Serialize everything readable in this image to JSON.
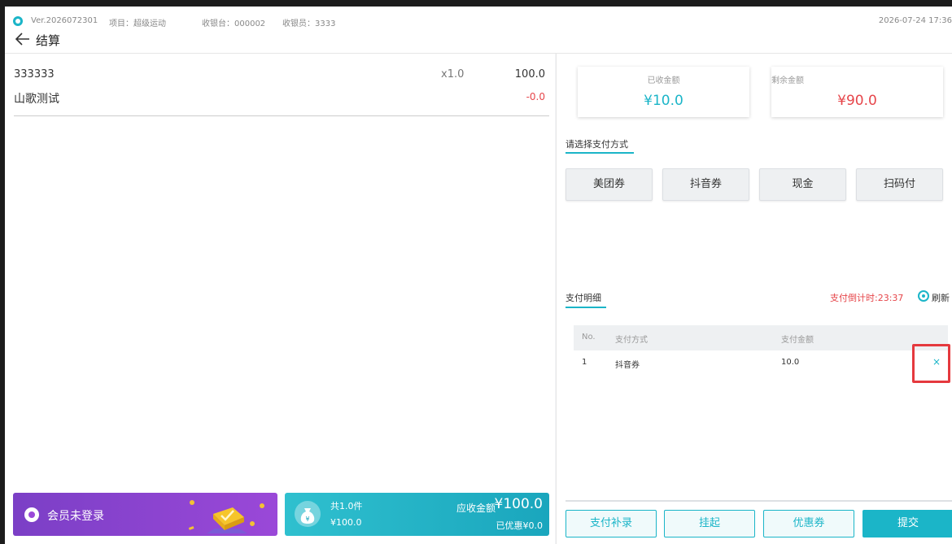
{
  "header": {
    "version": "Ver.2026072301",
    "project": "项目：超级运动",
    "counter": "收银台：000002",
    "cashier": "收银员：3333",
    "datetime": "2026-07-24 17:36",
    "page_title": "结算"
  },
  "order": {
    "item": {
      "name": "333333",
      "qty": "x1.0",
      "price": "100.0",
      "sub_name": "山歌测试",
      "discount": "-0.0"
    }
  },
  "member": {
    "label": "会员未登录"
  },
  "summary": {
    "count": "共1.0件",
    "total": "¥100.0",
    "due_label": "应收金额",
    "due_amount": "¥100.0",
    "discount": "已优惠¥0.0"
  },
  "amounts": {
    "received_label": "已收金额",
    "received_value": "¥10.0",
    "remaining_label": "剩余金额",
    "remaining_value": "¥90.0"
  },
  "payment_methods": {
    "title": "请选择支付方式",
    "options": [
      "美团券",
      "抖音券",
      "现金",
      "扫码付"
    ]
  },
  "payment_details": {
    "title": "支付明细",
    "countdown": "支付倒计时:23:37",
    "refresh_label": "刷新",
    "columns": [
      "No.",
      "支付方式",
      "支付金额"
    ],
    "rows": [
      {
        "no": "1",
        "method": "抖音券",
        "amount": "10.0",
        "delete": "×"
      }
    ]
  },
  "actions": {
    "supplement": "支付补录",
    "hold": "挂起",
    "coupon": "优惠券",
    "submit": "提交"
  },
  "colors": {
    "accent": "#1bb5c8",
    "danger": "#e6454a",
    "member_card": "#9a48d8"
  }
}
